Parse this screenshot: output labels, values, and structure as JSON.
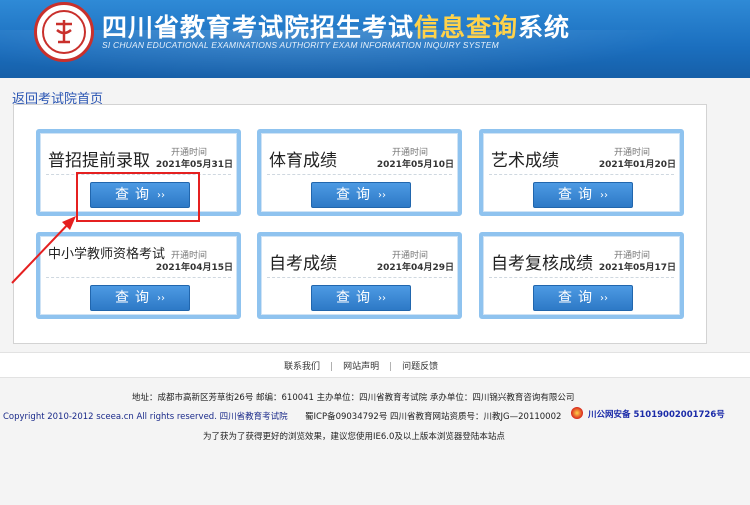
{
  "header": {
    "title_part1": "四川省教育考试院招生考试",
    "title_part2": "信息查询",
    "title_part3": "系统",
    "title_en": "SI CHUAN EDUCATIONAL EXAMINATIONS AUTHORITY EXAM INFORMATION INQUIRY SYSTEM",
    "logo_icon": "authority-seal-icon"
  },
  "nav": {
    "back_link": "返回考试院首页"
  },
  "cards": [
    {
      "title": "普招提前录取",
      "open_label": "开通时间",
      "open_date": "2021年05月31日",
      "button": "查询",
      "arrow": "››"
    },
    {
      "title": "体育成绩",
      "open_label": "开通时间",
      "open_date": "2021年05月10日",
      "button": "查询",
      "arrow": "››"
    },
    {
      "title": "艺术成绩",
      "open_label": "开通时间",
      "open_date": "2021年01月20日",
      "button": "查询",
      "arrow": "››"
    },
    {
      "title": "中小学教师资格考试",
      "open_label": "开通时间",
      "open_date": "2021年04月15日",
      "button": "查询",
      "arrow": "››"
    },
    {
      "title": "自考成绩",
      "open_label": "开通时间",
      "open_date": "2021年04月29日",
      "button": "查询",
      "arrow": "››"
    },
    {
      "title": "自考复核成绩",
      "open_label": "开通时间",
      "open_date": "2021年05月17日",
      "button": "查询",
      "arrow": "››"
    }
  ],
  "footer": {
    "links": [
      "联系我们",
      "网站声明",
      "问题反馈"
    ],
    "address": "地址：成都市高新区芳草街26号 邮编：610041    主办单位：四川省教育考试院  承办单位：四川锦兴教育咨询有限公司",
    "copyright": "Copyright 2010-2012 sceea.cn All rights reserved. 四川省教育考试院",
    "icp": "蜀ICP备09034792号 四川省教育网站资质号：川教JG—20110002",
    "police": "川公网安备 51019002001726号",
    "browser_note": "为了获为了获得更好的浏览效果，建议您使用IE6.0及以上版本浏览器登陆本站点"
  },
  "colors": {
    "header_blue": "#1b6fbf",
    "title_highlight": "#ffd24a",
    "button_blue": "#2d79c6",
    "card_border": "#8fc3ef",
    "annotation_red": "#e52020"
  }
}
